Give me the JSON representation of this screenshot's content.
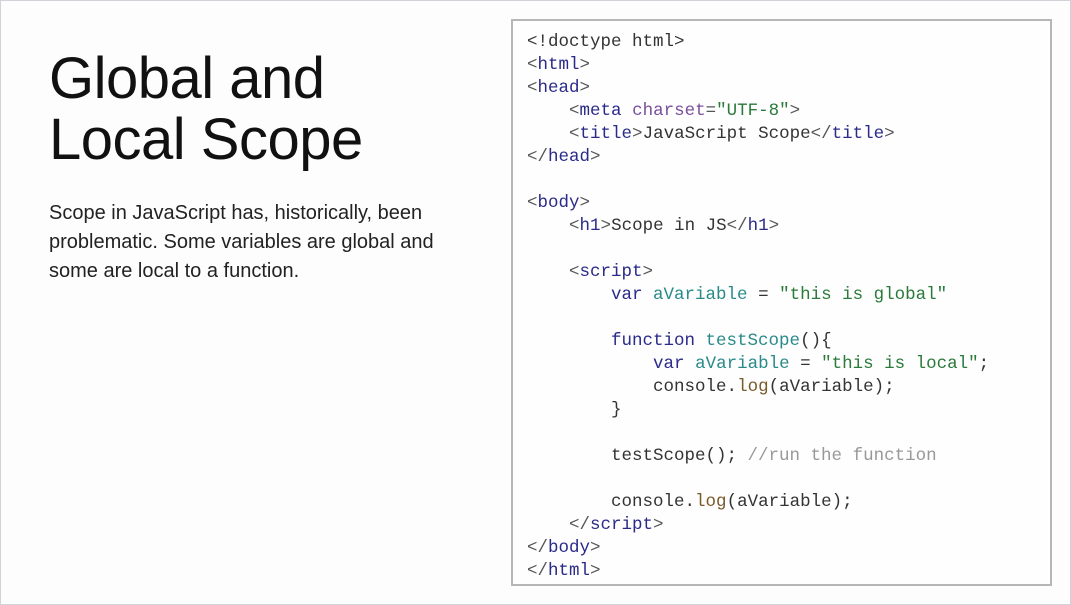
{
  "slide": {
    "title": "Global and Local Scope",
    "description": "Scope in JavaScript has, historically, been problematic. Some variables are global and some are local to a function."
  },
  "code": {
    "l01_decl": "<!doctype html>",
    "l02_open": "<",
    "l02_tag": "html",
    "l02_close": ">",
    "l03_open": "<",
    "l03_tag": "head",
    "l03_close": ">",
    "l04_indent": "    ",
    "l04_open": "<",
    "l04_tag": "meta",
    "l04_sp": " ",
    "l04_attr": "charset",
    "l04_eq": "=",
    "l04_val": "\"UTF-8\"",
    "l04_close": ">",
    "l05_indent": "    ",
    "l05_open": "<",
    "l05_tag": "title",
    "l05_close": ">",
    "l05_text": "JavaScript Scope",
    "l05_open2": "</",
    "l05_tag2": "title",
    "l05_close2": ">",
    "l06_open": "</",
    "l06_tag": "head",
    "l06_close": ">",
    "l07_blank": "",
    "l08_open": "<",
    "l08_tag": "body",
    "l08_close": ">",
    "l09_indent": "    ",
    "l09_open": "<",
    "l09_tag": "h1",
    "l09_close": ">",
    "l09_text": "Scope in JS",
    "l09_open2": "</",
    "l09_tag2": "h1",
    "l09_close2": ">",
    "l10_blank": "",
    "l11_indent": "    ",
    "l11_open": "<",
    "l11_tag": "script",
    "l11_close": ">",
    "l12_indent": "        ",
    "l12_kw": "var",
    "l12_sp": " ",
    "l12_id": "aVariable",
    "l12_rest": " = ",
    "l12_str": "\"this is global\"",
    "l13_blank": "",
    "l14_indent": "        ",
    "l14_kw": "function",
    "l14_sp": " ",
    "l14_id": "testScope",
    "l14_rest": "(){",
    "l15_indent": "            ",
    "l15_kw": "var",
    "l15_sp": " ",
    "l15_id": "aVariable",
    "l15_rest": " = ",
    "l15_str": "\"this is local\"",
    "l15_semi": ";",
    "l16_indent": "            ",
    "l16_obj": "console",
    "l16_dot": ".",
    "l16_fn": "log",
    "l16_rest": "(aVariable);",
    "l17_indent": "        ",
    "l17_brace": "}",
    "l18_blank": "",
    "l19_indent": "        ",
    "l19_call": "testScope(); ",
    "l19_cmt": "//run the function",
    "l20_blank": "",
    "l21_indent": "        ",
    "l21_obj": "console",
    "l21_dot": ".",
    "l21_fn": "log",
    "l21_rest": "(aVariable);",
    "l22_indent": "    ",
    "l22_open": "</",
    "l22_tag": "script",
    "l22_close": ">",
    "l23_open": "</",
    "l23_tag": "body",
    "l23_close": ">",
    "l24_open": "</",
    "l24_tag": "html",
    "l24_close": ">"
  }
}
